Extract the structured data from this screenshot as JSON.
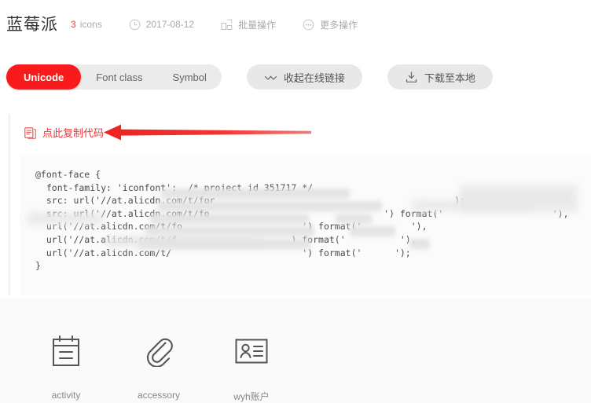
{
  "header": {
    "project_title": "蓝莓派",
    "icon_count": "3",
    "icon_count_unit": "icons",
    "date": "2017-08-12",
    "batch_action": "批量操作",
    "more_action": "更多操作"
  },
  "tabs": [
    {
      "label": "Unicode",
      "active": true
    },
    {
      "label": "Font class",
      "active": false
    },
    {
      "label": "Symbol",
      "active": false
    }
  ],
  "buttons": {
    "collapse_link": "收起在线链接",
    "download_local": "下载至本地"
  },
  "copy": {
    "label": "点此复制代码"
  },
  "code": {
    "lines": [
      "@font-face {",
      "  font-family: 'iconfont';  /* project id 351717 */",
      "  src: url('//at.alicdn.com/t/for                                            );",
      "  src: url('//at.alicdn.com/t/fo                                ') format('                    '),",
      "  url('//at.alicdn.com/t/fo                      ') format('         '),",
      "  url('//at.alicdn.com/t/f                     ) format('          '),",
      "  url('//at.alicdn.com/t/                        ') format('      ');",
      "}"
    ]
  },
  "icons": [
    {
      "label": "activity",
      "glyph": "clipboard-icon"
    },
    {
      "label": "accessory",
      "glyph": "paperclip-icon"
    },
    {
      "label": "wyh账户",
      "glyph": "id-card-icon"
    }
  ],
  "colors": {
    "accent_red": "#f91b1b",
    "link_red": "#f03535",
    "tab_bg": "#ebebeb",
    "button_bg": "#e8e8e8",
    "code_bg": "#fbfbfb"
  }
}
